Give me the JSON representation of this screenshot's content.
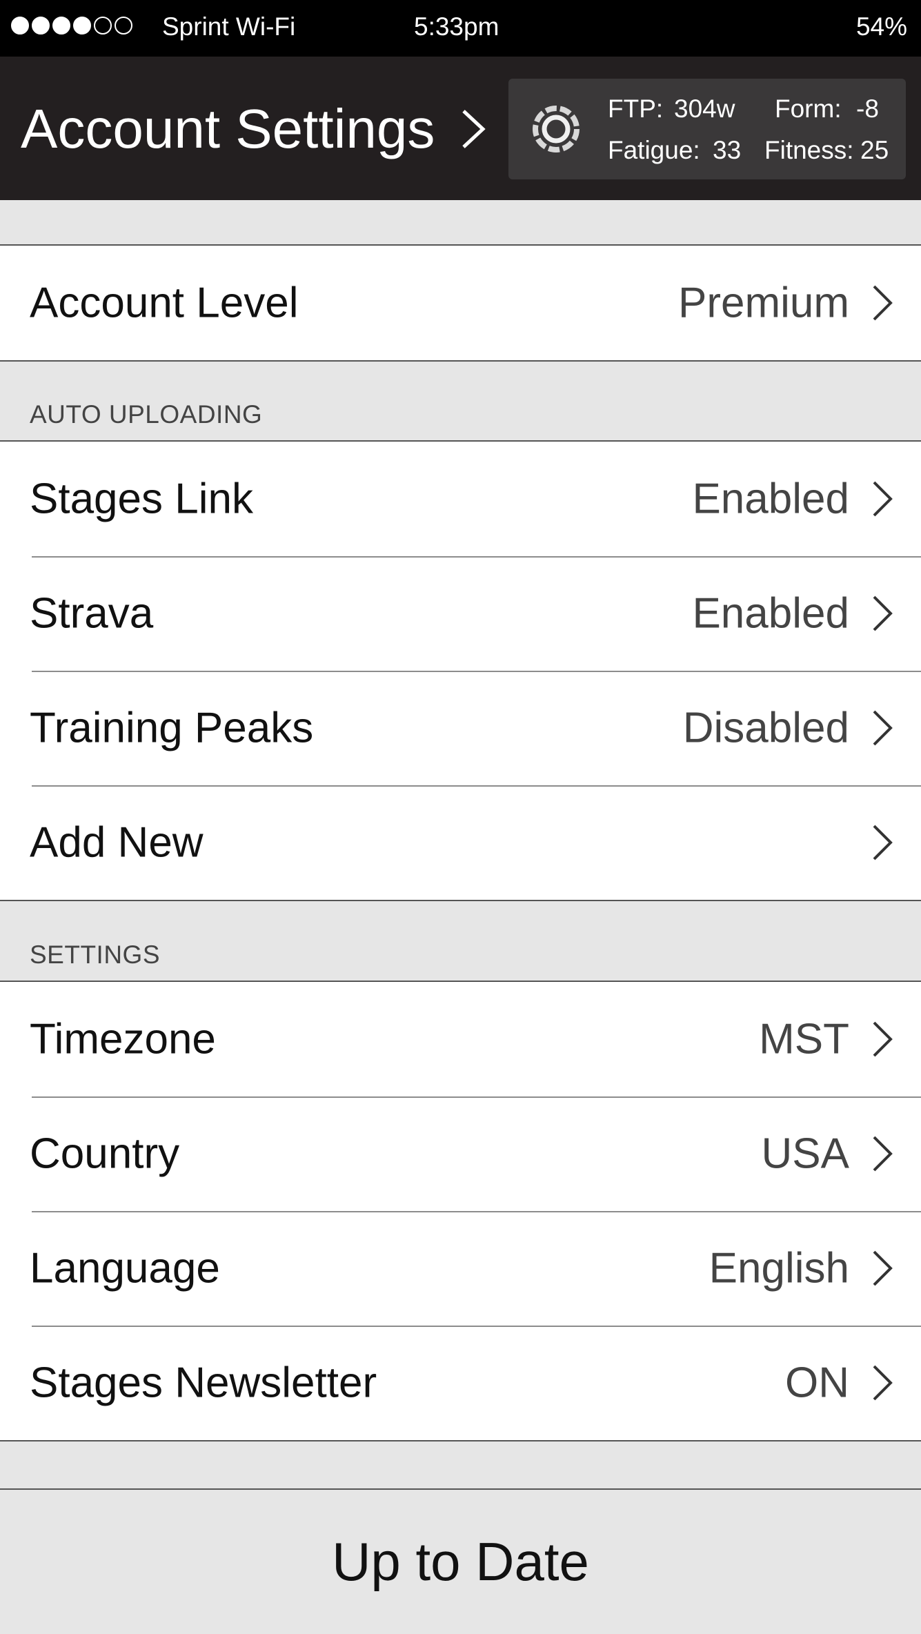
{
  "status_bar": {
    "carrier": "Sprint Wi-Fi",
    "time": "5:33pm",
    "battery": "54%",
    "signal_filled": 4,
    "signal_total": 6
  },
  "header": {
    "title": "Account Settings",
    "stats": {
      "ftp_label": "FTP:",
      "ftp_value": "304w",
      "form_label": "Form:",
      "form_value": "-8",
      "fatigue_label": "Fatigue:",
      "fatigue_value": "33",
      "fitness_label": "Fitness:",
      "fitness_value": "25"
    }
  },
  "account": {
    "level_label": "Account Level",
    "level_value": "Premium"
  },
  "auto_uploading": {
    "title": "AUTO UPLOADING",
    "items": [
      {
        "label": "Stages Link",
        "value": "Enabled"
      },
      {
        "label": "Strava",
        "value": "Enabled"
      },
      {
        "label": "Training Peaks",
        "value": "Disabled"
      },
      {
        "label": "Add New",
        "value": ""
      }
    ]
  },
  "settings": {
    "title": "SETTINGS",
    "items": [
      {
        "label": "Timezone",
        "value": "MST"
      },
      {
        "label": "Country",
        "value": "USA"
      },
      {
        "label": "Language",
        "value": "English"
      },
      {
        "label": "Stages Newsletter",
        "value": "ON"
      }
    ]
  },
  "footer": {
    "button_label": "Up to Date"
  },
  "icons": {
    "chevron": "chevron-right-icon",
    "app_logo": "stages-logo-icon"
  },
  "colors": {
    "status_bar_bg": "#000000",
    "header_bg": "#231f20",
    "stats_box_bg": "#3a3839",
    "page_bg": "#e6e6e6",
    "row_bg": "#ffffff"
  }
}
